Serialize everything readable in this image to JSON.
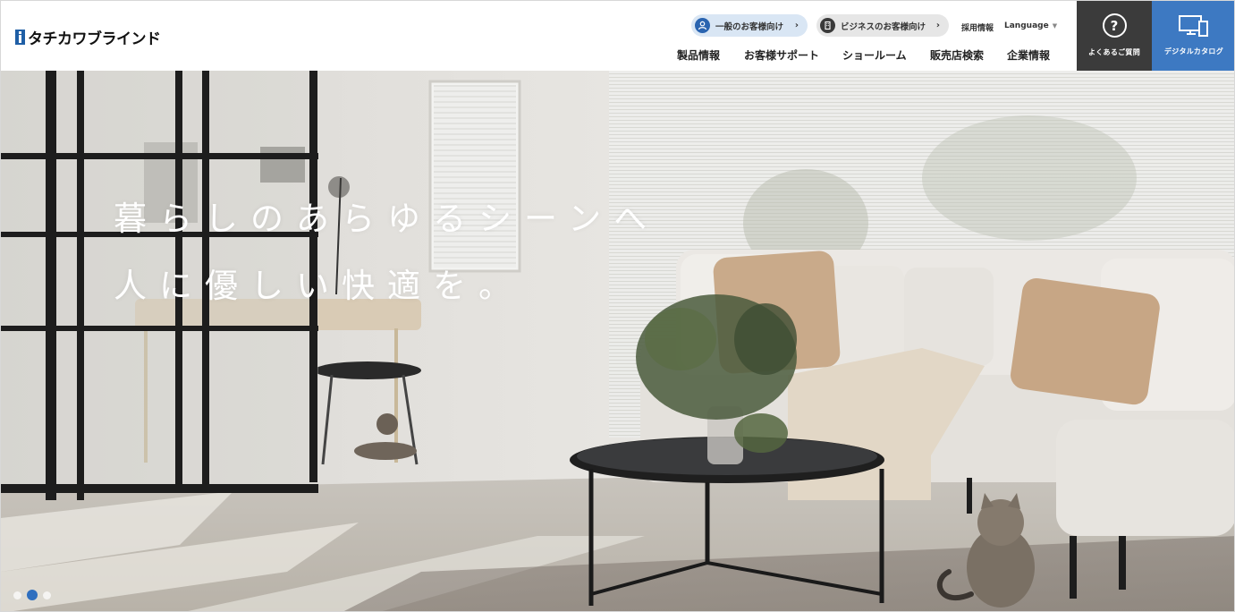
{
  "header": {
    "logo_text": "タチカワブラインド",
    "audience_links": [
      {
        "label": "一般のお客様向け",
        "icon": "person-icon"
      },
      {
        "label": "ビジネスのお客様向け",
        "icon": "building-icon"
      }
    ],
    "recruit_label": "採用情報",
    "language_label": "Language",
    "nav": [
      {
        "label": "製品情報"
      },
      {
        "label": "お客様サポート"
      },
      {
        "label": "ショールーム"
      },
      {
        "label": "販売店検索"
      },
      {
        "label": "企業情報"
      }
    ],
    "faq_label": "よくあるご質問",
    "catalog_label": "デジタルカタログ"
  },
  "hero": {
    "tagline_line1": "暮らしのあらゆるシーンへ",
    "tagline_line2": "人に優しい快適を。",
    "slides_total": 3,
    "active_slide": 2
  },
  "colors": {
    "brand_blue": "#3d79c2",
    "faq_dark": "#3b3b3b",
    "consumer_pill": "#d9e6f4",
    "business_pill": "#e6e6e6"
  }
}
